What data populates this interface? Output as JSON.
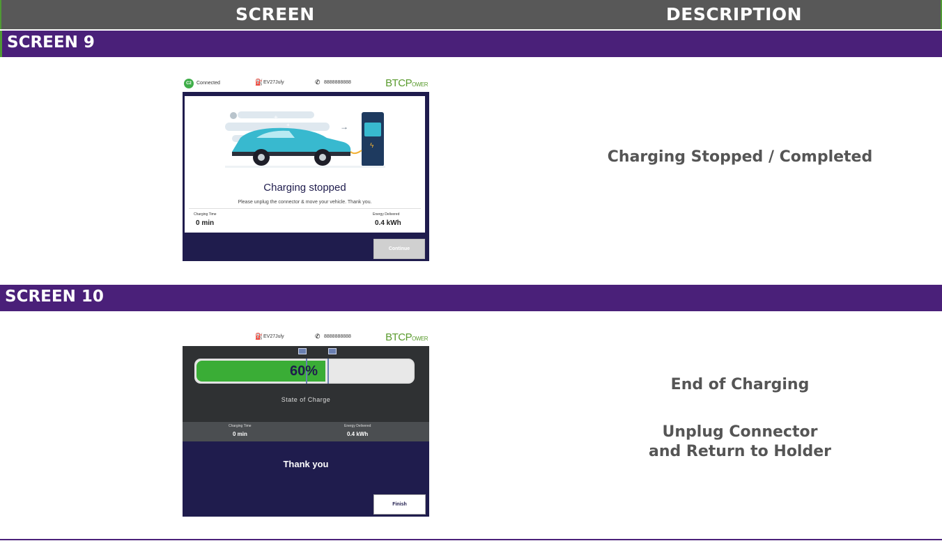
{
  "header": {
    "screen_label": "SCREEN",
    "description_label": "DESCRIPTION"
  },
  "sections": [
    {
      "title": "SCREEN 9",
      "description": [
        "Charging Stopped / Completed"
      ],
      "kiosk": {
        "connection_badge": "C2",
        "connection_label": "Connected",
        "station_id": "EV27July",
        "phone": "8888888888",
        "brand_main": "BTCP",
        "brand_sub": "OWER",
        "heading": "Charging stopped",
        "message": "Please unplug the connector & move your vehicle. Thank you.",
        "charging_time_label": "Charging Time",
        "charging_time_value": "0 min",
        "energy_label": "Energy Delivered",
        "energy_value": "0.4 kWh",
        "button_label": "Continue"
      }
    },
    {
      "title": "SCREEN 10",
      "description": [
        "End of Charging",
        "Unplug Connector",
        "and Return to Holder"
      ],
      "kiosk": {
        "station_id": "EV27July",
        "phone": "8888888888",
        "brand_main": "BTCP",
        "brand_sub": "OWER",
        "soc_percent": 60,
        "soc_text": "60%",
        "soc_label": "State of Charge",
        "charging_time_label": "Charging Time",
        "charging_time_value": "0 min",
        "energy_label": "Energy Delivered",
        "energy_value": "0.4 kWh",
        "message": "Thank you",
        "button_label": "Finish"
      }
    }
  ],
  "colors": {
    "header_bg": "#585858",
    "section_bg": "#4a2079",
    "accent_green": "#4f9a34",
    "kiosk_navy": "#1f1c4d",
    "soc_green": "#3aad36"
  },
  "icons": [
    "connector-badge-icon",
    "charging-station-icon",
    "phone-icon",
    "ev-car-illustration",
    "soc-marker-icon"
  ]
}
